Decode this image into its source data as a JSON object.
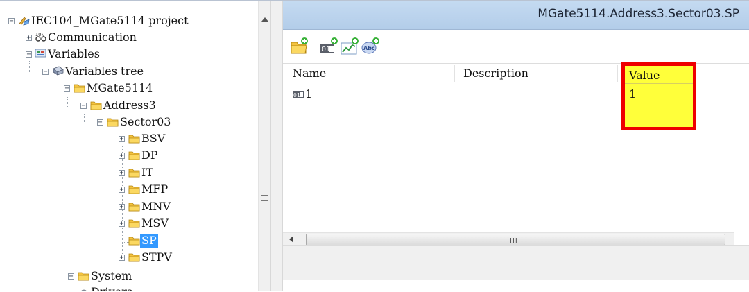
{
  "tree": {
    "root": {
      "label": "IEC104_MGate5114 project",
      "icon": "project-icon"
    },
    "communication": {
      "label": "Communication",
      "icon": "communication-icon"
    },
    "variables": {
      "label": "Variables",
      "icon": "variables-icon"
    },
    "variables_tree": {
      "label": "Variables tree",
      "icon": "variables-tree-icon"
    },
    "mgate": {
      "label": "MGate5114",
      "icon": "folder-icon"
    },
    "address3": {
      "label": "Address3",
      "icon": "folder-icon"
    },
    "sector03": {
      "label": "Sector03",
      "icon": "folder-icon"
    },
    "sector_children": [
      {
        "label": "BSV"
      },
      {
        "label": "DP"
      },
      {
        "label": "IT"
      },
      {
        "label": "MFP"
      },
      {
        "label": "MNV"
      },
      {
        "label": "MSV"
      },
      {
        "label": "SP",
        "selected": true
      },
      {
        "label": "STPV"
      }
    ],
    "system": {
      "label": "System",
      "icon": "folder-icon"
    },
    "next_truncated": {
      "label": "Drivers"
    }
  },
  "panel": {
    "title": "MGate5114.Address3.Sector03.SP",
    "toolbar": [
      "new-folder-icon",
      "new-variable-icon",
      "new-chart-icon",
      "new-text-icon"
    ],
    "columns": {
      "name": "Name",
      "description": "Description",
      "value": "Value"
    },
    "rows": [
      {
        "icon": "binary-variable-icon",
        "name": "1",
        "description": "",
        "value": "1"
      }
    ],
    "scroll_grip": "III"
  },
  "colors": {
    "highlight_fill": "#ffff3a",
    "highlight_border": "#ee0000",
    "selection": "#3399ff",
    "title_bar": "#bcd4ee"
  }
}
